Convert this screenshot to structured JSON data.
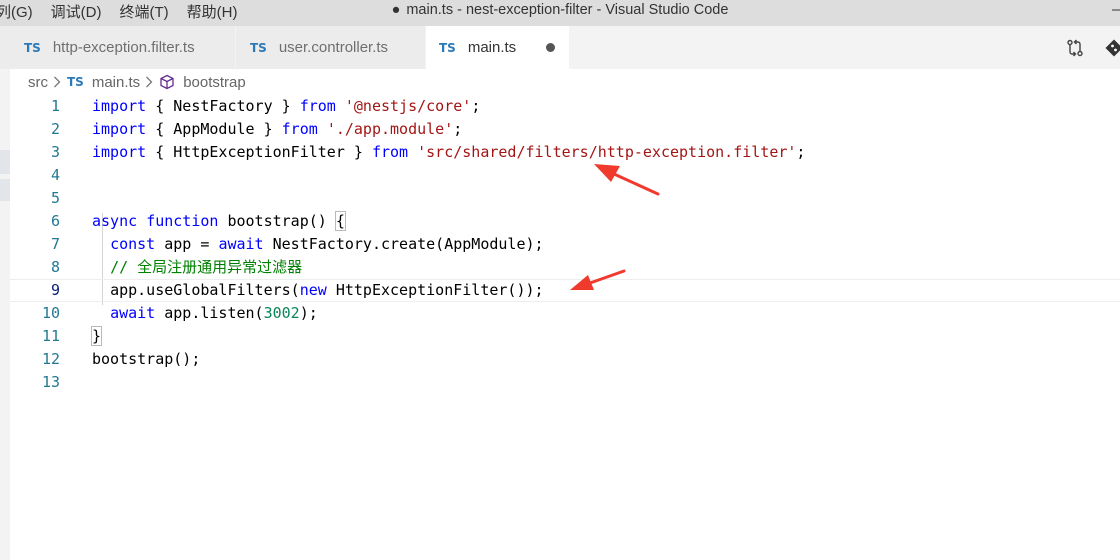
{
  "menu": [
    "列(G)",
    "调试(D)",
    "终端(T)",
    "帮助(H)"
  ],
  "window": {
    "dirty_dot": "●",
    "title": "main.ts - nest-exception-filter - Visual Studio Code"
  },
  "tabs": [
    {
      "badge": "TS",
      "label": "http-exception.filter.ts",
      "active": false
    },
    {
      "badge": "TS",
      "label": "user.controller.ts",
      "active": false
    },
    {
      "badge": "TS",
      "label": "main.ts",
      "active": true,
      "unsaved": true
    }
  ],
  "breadcrumb": {
    "folder": "src",
    "file_badge": "TS",
    "file": "main.ts",
    "symbol": "bootstrap"
  },
  "icons": {
    "compare": "source-control-compare-icon",
    "open_changes": "git-icon",
    "symbol": "method-cube-icon"
  },
  "colors": {
    "keyword": "#0000ff",
    "string": "#a31515",
    "comment": "#008000",
    "number": "#098658",
    "line_number": "#237893",
    "ts_badge": "#2a7ab9",
    "arrow": "#f03a2e"
  },
  "editor": {
    "line_numbers": [
      "1",
      "2",
      "3",
      "4",
      "5",
      "6",
      "7",
      "8",
      "9",
      "10",
      "11",
      "12",
      "13"
    ],
    "tokens": {
      "import": "import",
      "from": "from",
      "lbrace": "{",
      "rbrace": "}",
      "semicolon": ";",
      "nest_factory": "NestFactory",
      "app_module": "AppModule",
      "http_exception_filter": "HttpExceptionFilter",
      "str_core": "'@nestjs/core'",
      "str_app_module": "'./app.module'",
      "str_filter_path": "'src/shared/filters/http-exception.filter'",
      "async": "async",
      "function": "function",
      "bootstrap_sig": "bootstrap() ",
      "const": "const",
      "app_eq": "app = ",
      "await": "await",
      "create_call": "NestFactory.create(AppModule);",
      "comment": "// 全局注册通用异常过滤器",
      "use_filters_open": "app.useGlobalFilters(",
      "new": "new",
      "use_filters_close": "HttpExceptionFilter());",
      "listen_open": "app.listen(",
      "port": "3002",
      "listen_close": ");",
      "bootstrap_call": "bootstrap();"
    }
  }
}
